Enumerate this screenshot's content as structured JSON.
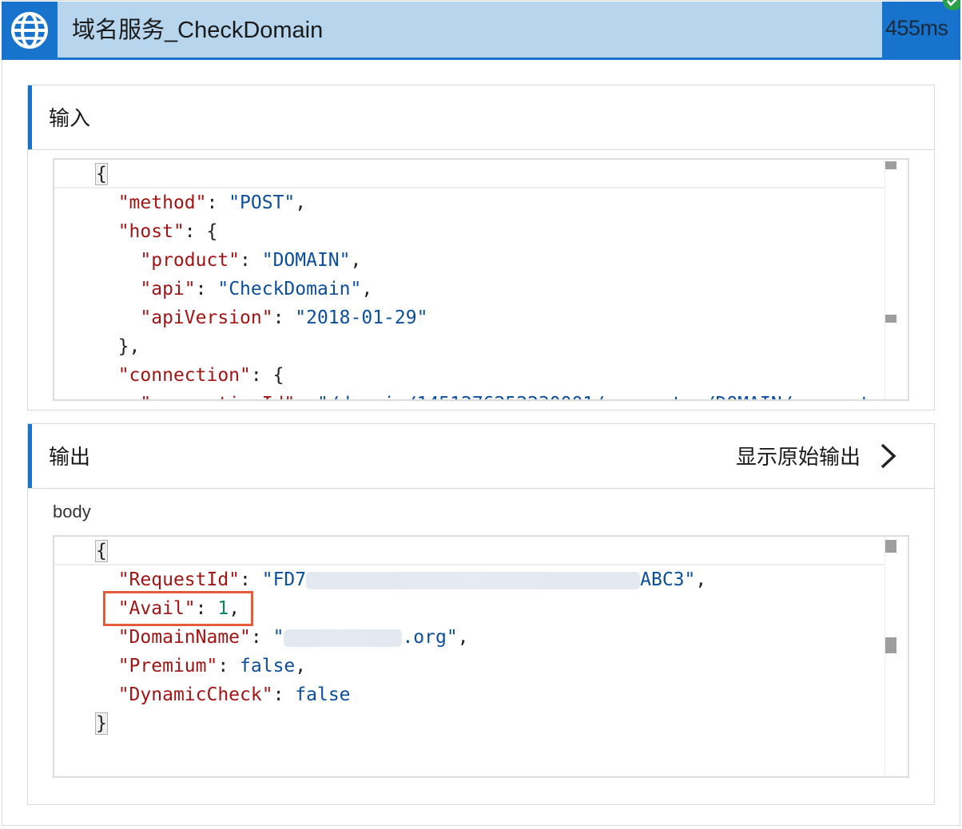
{
  "header": {
    "title": "域名服务_CheckDomain",
    "timing": "455ms",
    "icon": "globe-icon",
    "status_icon": "check-icon"
  },
  "input_section": {
    "title": "输入",
    "code_lines": [
      "{",
      "\"method\": \"POST\",",
      "\"host\": {",
      "\"product\": \"DOMAIN\",",
      "\"api\": \"CheckDomain\",",
      "\"apiVersion\": \"2018-01-29\"",
      "},",
      "\"connection\": {"
    ]
  },
  "output_section": {
    "title": "输出",
    "raw_link": "显示原始输出",
    "body_label": "body",
    "code": {
      "open": "{",
      "request_id_key": "\"RequestId\"",
      "request_id_prefix": "\"FD7",
      "request_id_suffix": "ABC3\"",
      "avail_key": "\"Avail\"",
      "avail_value": "1",
      "domain_key": "\"DomainName\"",
      "domain_prefix": "\"",
      "domain_suffix": ".org\"",
      "premium_key": "\"Premium\"",
      "premium_value": "false",
      "dynamic_key": "\"DynamicCheck\"",
      "dynamic_value": "false",
      "close": "}"
    }
  },
  "colors": {
    "accent": "#1873cc",
    "header_bg": "#b8d5ee",
    "json_key": "#a31515",
    "json_string": "#0b4f9c",
    "json_number": "#098658",
    "highlight": "#e55b3c"
  }
}
